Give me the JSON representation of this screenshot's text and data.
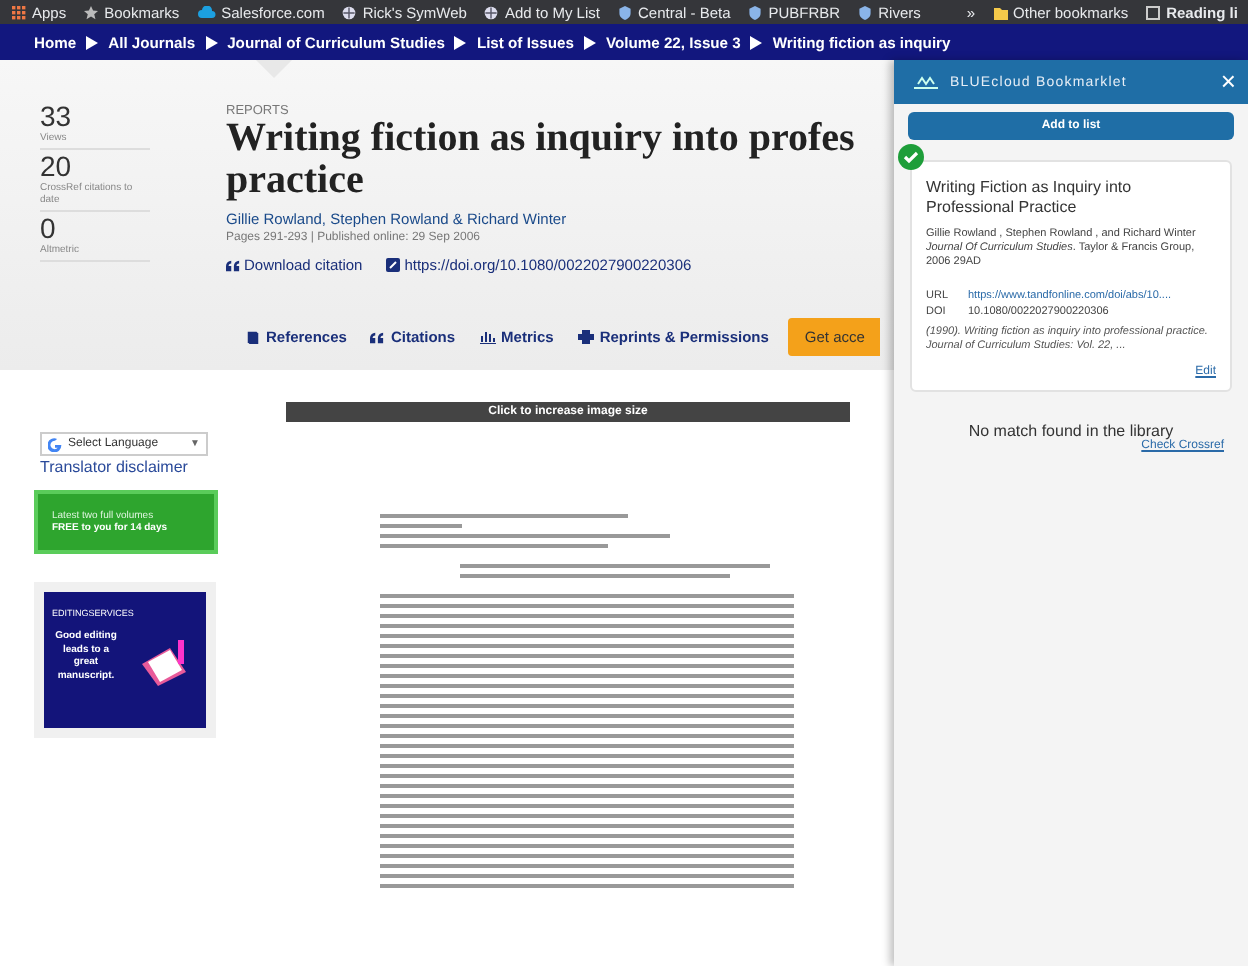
{
  "bookmarks_bar": {
    "items": [
      {
        "label": "Apps",
        "kind": "grid"
      },
      {
        "label": "Bookmarks",
        "kind": "star"
      },
      {
        "label": "Salesforce.com",
        "kind": "cloud"
      },
      {
        "label": "Rick's SymWeb",
        "kind": "globe"
      },
      {
        "label": "Add to My List",
        "kind": "globe"
      },
      {
        "label": "Central - Beta",
        "kind": "badge"
      },
      {
        "label": "PUBFRBR",
        "kind": "badge"
      },
      {
        "label": "Rivers",
        "kind": "badge"
      }
    ],
    "overflow": "»",
    "other": "Other bookmarks",
    "reading": "Reading li"
  },
  "breadcrumb": [
    "Home",
    "All Journals",
    "Journal of Curriculum Studies",
    "List of Issues",
    "Volume 22, Issue 3",
    "Writing fiction as inquiry"
  ],
  "metrics": [
    {
      "value": "33",
      "label": "Views"
    },
    {
      "value": "20",
      "label": "CrossRef citations to date"
    },
    {
      "value": "0",
      "label": "Altmetric"
    }
  ],
  "article": {
    "section": "REPORTS",
    "title_line_1": "Writing fiction as inquiry into profes",
    "title_line_2": "practice",
    "authors": "Gillie Rowland, Stephen Rowland & Richard Winter",
    "meta": "Pages 291-293 | Published online: 29 Sep 2006",
    "download": "Download citation",
    "doi": "https://doi.org/10.1080/0022027900220306"
  },
  "article_tabs": [
    {
      "label": "References",
      "kind": "book"
    },
    {
      "label": "Citations",
      "kind": "quote"
    },
    {
      "label": "Metrics",
      "kind": "chart"
    },
    {
      "label": "Reprints & Permissions",
      "kind": "print"
    }
  ],
  "get_access": "Get acce",
  "translator": {
    "select": "Select Language",
    "arrow": "▼",
    "disclaimer": "Translator disclaimer"
  },
  "promo": {
    "line_1": "Latest two full volumes",
    "line_2": "FREE to you for 14 days"
  },
  "ad": {
    "brand": "EDITINGSERVICES",
    "text": "Good editing leads to a great manuscript."
  },
  "preview_bar": "Click to increase image size",
  "bookmarklet": {
    "title": "BLUEcloud Bookmarklet",
    "close": "×",
    "add_button": "Add to list",
    "added": true,
    "record": {
      "title": "Writing Fiction as Inquiry into Professional Practice",
      "authors": "Gillie   Rowland , Stephen   Rowland , and Richard   Winter",
      "source": "Journal Of Curriculum Studies",
      "publisher": ". Taylor & Francis Group, 2006 29AD",
      "url_label": "URL",
      "url": "https://www.tandfonline.com/doi/abs/10....",
      "doi_label": "DOI",
      "doi": "10.1080/0022027900220306",
      "citation": "(1990). Writing fiction as inquiry into professional practice. Journal of Curriculum Studies: Vol. 22, ...",
      "edit": "Edit"
    },
    "status": "No match found in the library",
    "check": "Check Crossref"
  }
}
